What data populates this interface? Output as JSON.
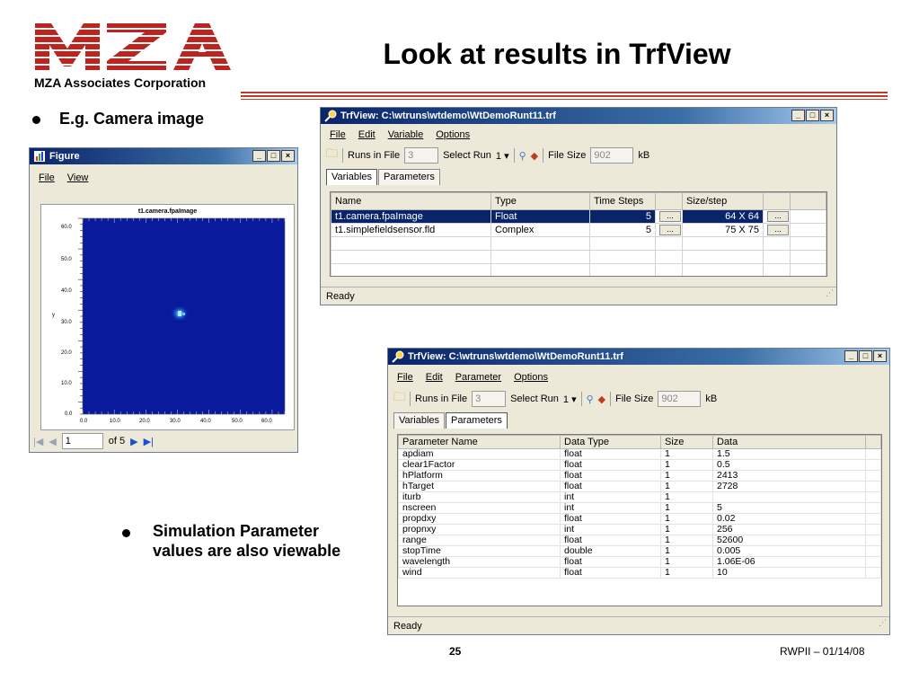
{
  "slide": {
    "title": "Look at results in TrfView",
    "company": "MZA Associates Corporation",
    "bullet1": "E.g. Camera image",
    "bullet2_line1": "Simulation Parameter",
    "bullet2_line2": "values are also viewable",
    "page_number": "25",
    "footer_right": "RWPII – 01/14/08"
  },
  "figure_window": {
    "title": "Figure",
    "menu": [
      "File",
      "View"
    ],
    "plot_title": "t1.camera.fpaImage",
    "ylabel": "y",
    "yticks": [
      "60.0",
      "50.0",
      "40.0",
      "30.0",
      "20.0",
      "10.0",
      "0.0"
    ],
    "xticks": [
      "0.0",
      "10.0",
      "20.0",
      "30.0",
      "40.0",
      "50.0",
      "60.0"
    ],
    "page_input": "1",
    "page_of": "of 5"
  },
  "trf1": {
    "title": "TrfView:  C:\\wtruns\\wtdemo\\WtDemoRunt11.trf",
    "menu": [
      "File",
      "Edit",
      "Variable",
      "Options"
    ],
    "runs_label": "Runs in File",
    "runs_value": "3",
    "select_run_label": "Select Run",
    "select_run_value": "1",
    "file_size_label": "File Size",
    "file_size_value": "902",
    "file_size_unit": "kB",
    "tabs": [
      "Variables",
      "Parameters"
    ],
    "columns": [
      "Name",
      "Type",
      "Time Steps",
      "",
      "Size/step",
      ""
    ],
    "rows": [
      {
        "name": "t1.camera.fpaImage",
        "type": "Float",
        "steps": "5",
        "size": "64 X 64"
      },
      {
        "name": "t1.simplefieldsensor.fld",
        "type": "Complex",
        "steps": "5",
        "size": "75 X 75"
      }
    ],
    "ellipsis": "...",
    "status": "Ready"
  },
  "trf2": {
    "title": "TrfView:  C:\\wtruns\\wtdemo\\WtDemoRunt11.trf",
    "menu": [
      "File",
      "Edit",
      "Parameter",
      "Options"
    ],
    "runs_label": "Runs in File",
    "runs_value": "3",
    "select_run_label": "Select Run",
    "select_run_value": "1",
    "file_size_label": "File Size",
    "file_size_value": "902",
    "file_size_unit": "kB",
    "tabs": [
      "Variables",
      "Parameters"
    ],
    "columns": [
      "Parameter Name",
      "Data Type",
      "Size",
      "Data"
    ],
    "rows": [
      {
        "name": "apdiam",
        "type": "float",
        "size": "1",
        "data": "1.5"
      },
      {
        "name": "clear1Factor",
        "type": "float",
        "size": "1",
        "data": "0.5"
      },
      {
        "name": "hPlatform",
        "type": "float",
        "size": "1",
        "data": "2413"
      },
      {
        "name": "hTarget",
        "type": "float",
        "size": "1",
        "data": "2728"
      },
      {
        "name": "iturb",
        "type": "int",
        "size": "1",
        "data": ""
      },
      {
        "name": "nscreen",
        "type": "int",
        "size": "1",
        "data": "5"
      },
      {
        "name": "propdxy",
        "type": "float",
        "size": "1",
        "data": "0.02"
      },
      {
        "name": "propnxy",
        "type": "int",
        "size": "1",
        "data": "256"
      },
      {
        "name": "range",
        "type": "float",
        "size": "1",
        "data": "52600"
      },
      {
        "name": "stopTime",
        "type": "double",
        "size": "1",
        "data": "0.005"
      },
      {
        "name": "wavelength",
        "type": "float",
        "size": "1",
        "data": "1.06E-06"
      },
      {
        "name": "wind",
        "type": "float",
        "size": "1",
        "data": "10"
      }
    ],
    "status": "Ready"
  }
}
